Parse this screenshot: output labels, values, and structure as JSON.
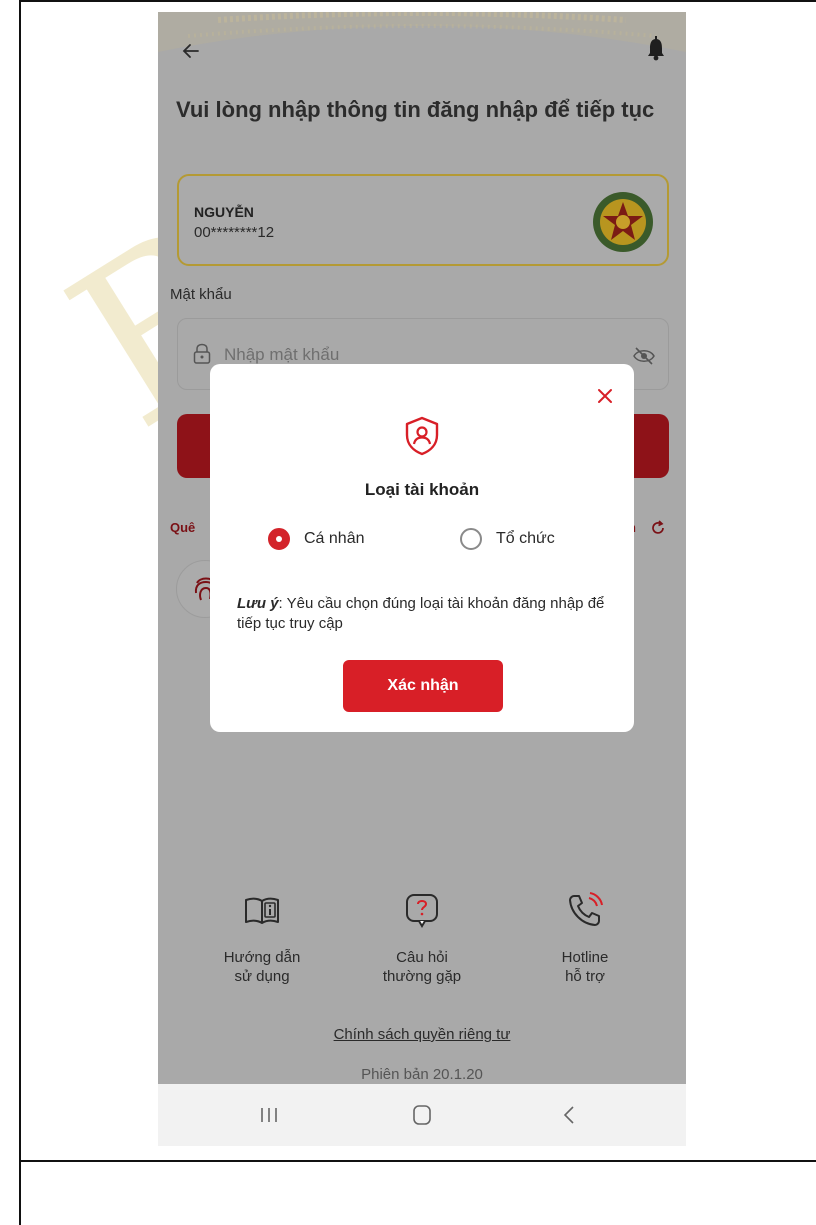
{
  "header": {
    "title": "Vui lòng nhập thông tin đăng nhập để tiếp tục"
  },
  "account": {
    "name": "NGUYỄN",
    "id": "00********12"
  },
  "password": {
    "label": "Mật khẩu",
    "placeholder": "Nhập mật khẩu"
  },
  "links": {
    "forgot_partial": "Quê",
    "switch_partial": "n"
  },
  "modal": {
    "title": "Loại tài khoản",
    "options": [
      {
        "label": "Cá nhân",
        "selected": true
      },
      {
        "label": "Tổ chức",
        "selected": false
      }
    ],
    "note_label": "Lưu ý",
    "note_text": ": Yêu cầu chọn đúng loại tài khoản đăng nhập để tiếp tục truy cập",
    "confirm_label": "Xác nhận"
  },
  "footer": {
    "items": [
      {
        "line1": "Hướng dẫn",
        "line2": "sử dụng",
        "icon": "book-info-icon"
      },
      {
        "line1": "Câu hỏi",
        "line2": "thường gặp",
        "icon": "question-bubble-icon"
      },
      {
        "line1": "Hotline",
        "line2": "hỗ trợ",
        "icon": "phone-call-icon"
      }
    ],
    "privacy": "Chính sách quyền riêng tư",
    "version": "Phiên bản 20.1.20"
  },
  "watermark": "BII",
  "colors": {
    "accent": "#d81f27",
    "overlay_gray": "#a9a9a9",
    "card_border": "#b49a34"
  }
}
